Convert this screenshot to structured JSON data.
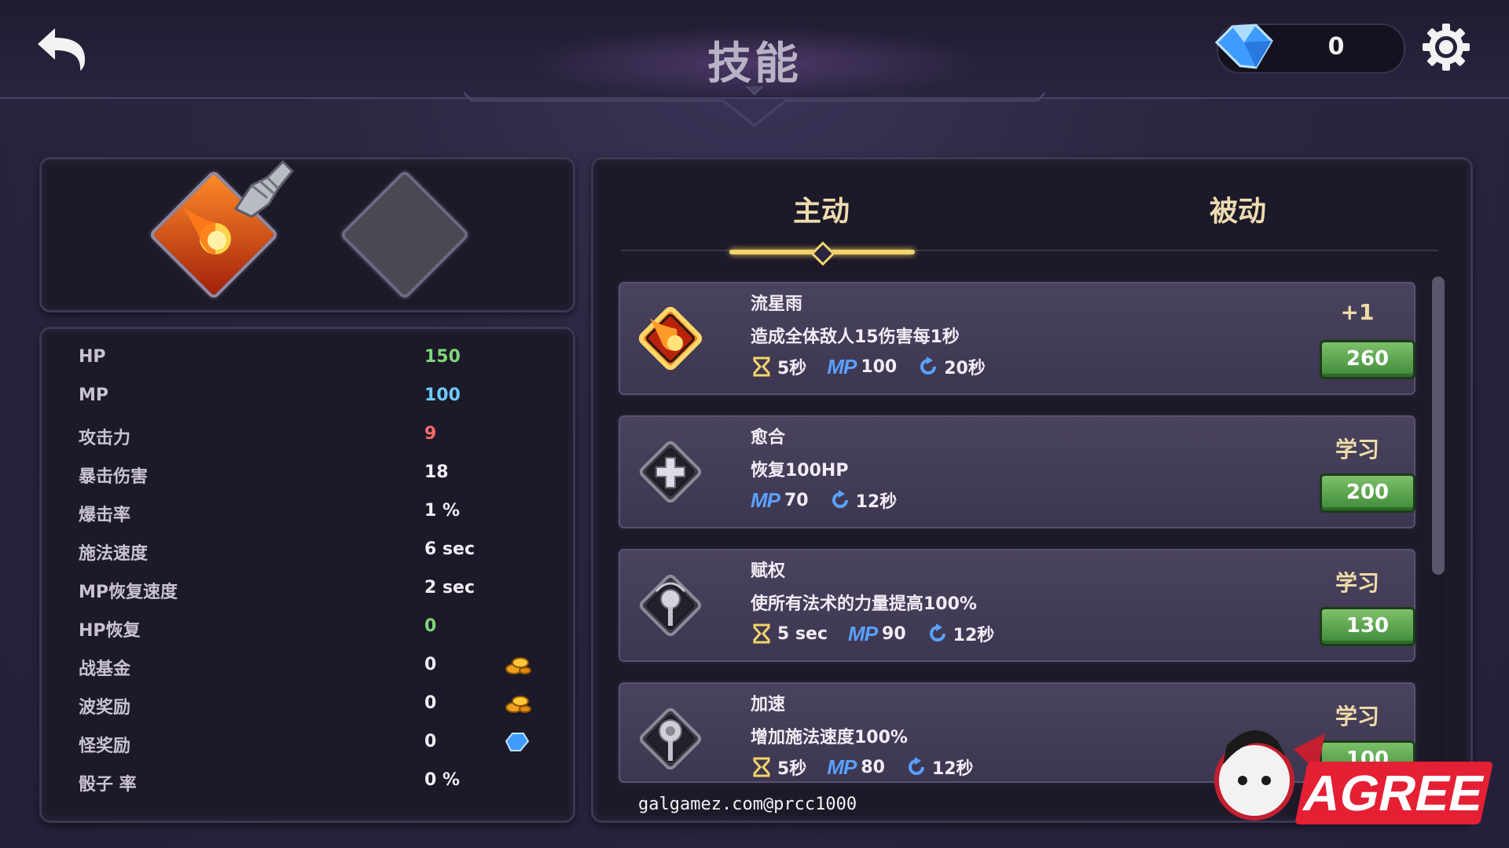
{
  "header": {
    "title": "技能",
    "gem_count": "0",
    "back_icon": "back-arrow-icon",
    "settings_icon": "gear-icon"
  },
  "equipped_slots": [
    {
      "skill": "流星雨",
      "icon": "meteor-fireball-icon"
    },
    {
      "skill": "",
      "icon": "empty-slot"
    }
  ],
  "stats": [
    {
      "label": "HP",
      "value": "150",
      "color": "#7fd67a"
    },
    {
      "label": "MP",
      "value": "100",
      "color": "#6fc9ff"
    },
    {
      "label": "攻击力",
      "value": "9",
      "color": "#ff6b6b"
    },
    {
      "label": "暴击伤害",
      "value": "18",
      "color": "#f1ecf5"
    },
    {
      "label": "爆击率",
      "value": "1 %",
      "color": "#f1ecf5"
    },
    {
      "label": "施法速度",
      "value": "6 sec",
      "color": "#f1ecf5"
    },
    {
      "label": "MP恢复速度",
      "value": "2 sec",
      "color": "#f1ecf5"
    },
    {
      "label": "HP恢复",
      "value": "0",
      "color": "#7fd67a"
    },
    {
      "label": "战基金",
      "value": "0",
      "color": "#f1ecf5",
      "icon": "gold-coins-icon"
    },
    {
      "label": "波奖励",
      "value": "0",
      "color": "#f1ecf5",
      "icon": "gold-coins-icon"
    },
    {
      "label": "怪奖励",
      "value": "0",
      "color": "#f1ecf5",
      "icon": "blue-gem-icon"
    },
    {
      "label": "骰子 率",
      "value": "0 %",
      "color": "#f1ecf5"
    }
  ],
  "tabs": [
    {
      "label": "主动",
      "active": true
    },
    {
      "label": "被动",
      "active": false
    }
  ],
  "skills": [
    {
      "name": "流星雨",
      "desc": "造成全体敌人15伤害每1秒",
      "cast": "5秒",
      "mp": "100",
      "cooldown": "20秒",
      "action": "+1",
      "price": "260",
      "icon": "meteor-fireball-icon"
    },
    {
      "name": "愈合",
      "desc": "恢复100HP",
      "cast": "",
      "mp": "70",
      "cooldown": "12秒",
      "action": "学习",
      "price": "200",
      "icon": "healing-cross-icon"
    },
    {
      "name": "赋权",
      "desc": "使所有法术的力量提高100%",
      "cast": "5 sec",
      "mp": "90",
      "cooldown": "12秒",
      "action": "学习",
      "price": "130",
      "icon": "empower-staff-icon"
    },
    {
      "name": "加速",
      "desc": "增加施法速度100%",
      "cast": "5秒",
      "mp": "80",
      "cooldown": "12秒",
      "action": "学习",
      "price": "100",
      "icon": "haste-staff-icon"
    }
  ],
  "mp_tag": "MP",
  "watermark": "galgamez.com@prcc1000",
  "logo_text": "AGREE",
  "colors": {
    "accent_gold": "#f4d56a",
    "button_green": "#5aa84e",
    "mp_blue": "#5aa0ff"
  }
}
